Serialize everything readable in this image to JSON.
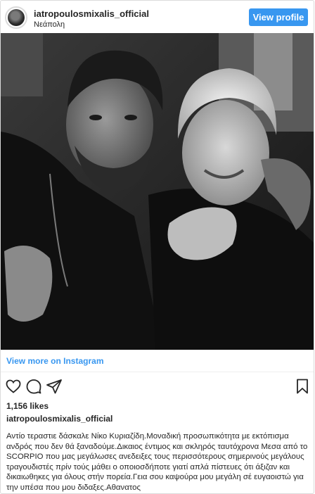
{
  "post": {
    "username": "iatropoulosmixalis_official",
    "location": "Νεάπολη",
    "view_profile_label": "View profile",
    "view_more_label": "View more on Instagram",
    "likes": "1,156 likes",
    "caption_username": "iatropoulosmixalis_official",
    "caption_text": "Αντίο τεραστιε δάσκαλε Νίκο Κυριαζίδη.Μοναδική προσωπικότητα με εκτόπισμα ανδρός που δεν θά ξαναδούμε.Δικαιος έντιμος και σκληρός ταυτόχρονα Μεσα από το SCORPIO που μας μεγάλωσες ανεδειξες τους περισσότερους σημερινούς μεγάλους τραγουδιστές πρίν τούς μάθει ο οποιοσδήποτε γιατί απλά πίστευες ότι άξιζαν και δικαιωθηκες για όλους στήν πορεία.Γεια σου καψούρα μου μεγάλη σέ ευγαοιστώ για την υπέσα που μου διδαξες.Αθανατος"
  },
  "icons": {
    "like": "heart-outline-icon",
    "comment": "comment-bubble-icon",
    "share": "share-paper-plane-icon",
    "save": "bookmark-outline-icon"
  },
  "colors": {
    "button_blue": "#3897f0",
    "link_blue": "#3897f0",
    "text": "#262626",
    "border": "#dbdbdb"
  }
}
